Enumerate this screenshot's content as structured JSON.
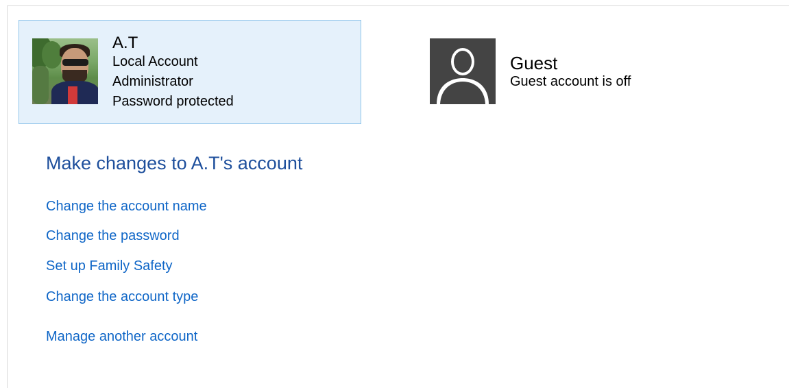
{
  "accounts": {
    "current": {
      "name": "A.T",
      "details": [
        "Local Account",
        "Administrator",
        "Password protected"
      ]
    },
    "guest": {
      "name": "Guest",
      "status": "Guest account is off"
    }
  },
  "changes": {
    "title": "Make changes to A.T's account",
    "links": [
      "Change the account name",
      "Change the password",
      "Set up Family Safety",
      "Change the account type"
    ],
    "manage_label": "Manage another account"
  },
  "colors": {
    "selected_tile_bg": "#e5f1fb",
    "selected_tile_border": "#8ec3ea",
    "title": "#1e4f9c",
    "link": "#0f66c7",
    "guest_avatar": "#444444"
  },
  "icons": {
    "guest_avatar": "user-silhouette-icon"
  }
}
